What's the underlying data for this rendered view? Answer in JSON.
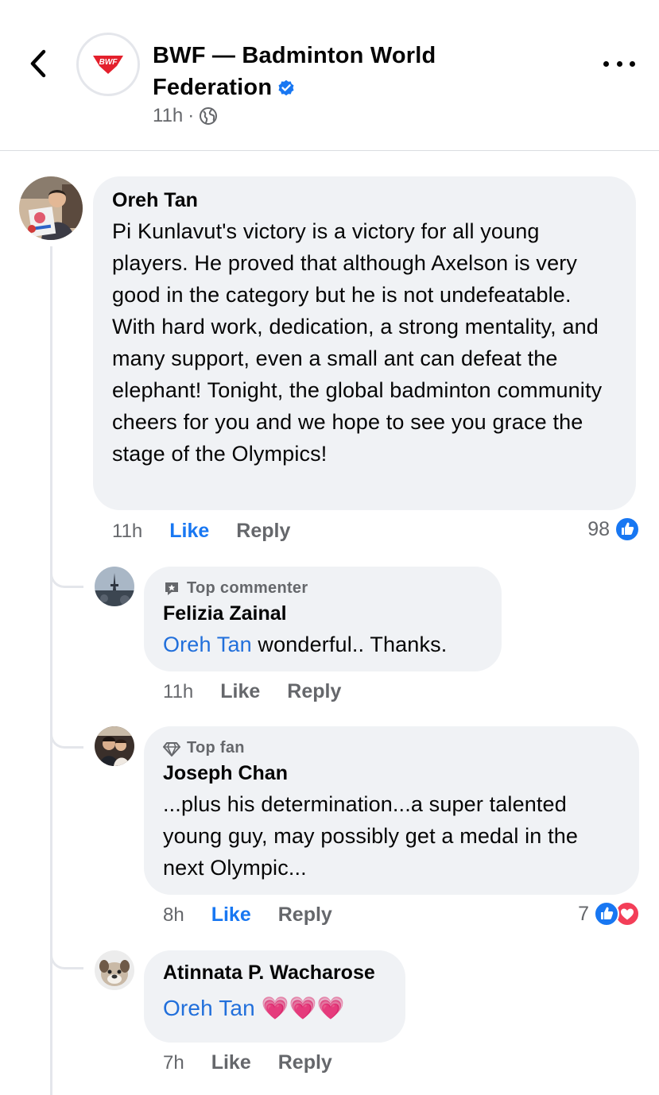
{
  "header": {
    "page_name": "BWF — Badminton World Federation",
    "time": "11h",
    "dot": "·",
    "logo_text": "BWF",
    "icons": {
      "back": "chevron-left-icon",
      "verified": "verified-badge-icon",
      "audience": "globe-icon",
      "more": "more-horizontal-icon"
    }
  },
  "colors": {
    "link": "#216fdb",
    "like_active": "#1877f2",
    "bubble": "#f0f2f5",
    "secondary_text": "#65676b",
    "logo_red": "#e4202c"
  },
  "comments": [
    {
      "author": "Oreh Tan",
      "text": "Pi Kunlavut's victory is a victory for all young players. He proved that although Axelson is very good in the category but he is not undefeatable. With hard work, dedication, a strong mentality, and many support, even a small ant can defeat the elephant! Tonight, the global badminton community cheers for you and we hope to see you grace the stage of the Olympics!",
      "time": "11h",
      "like_label": "Like",
      "reply_label": "Reply",
      "reaction_count": "98",
      "reactions": [
        "like"
      ]
    }
  ],
  "replies": [
    {
      "badge": "Top commenter",
      "author": "Felizia Zainal",
      "mention": "Oreh Tan",
      "text": " wonderful.. Thanks.",
      "time": "11h",
      "like_label": "Like",
      "reply_label": "Reply"
    },
    {
      "badge": "Top fan",
      "author": "Joseph Chan",
      "text": "...plus his determination...a super talented young guy, may possibly get a medal in the next Olympic...",
      "time": "8h",
      "like_label": "Like",
      "reply_label": "Reply",
      "reaction_count": "7",
      "reactions": [
        "like",
        "love"
      ]
    },
    {
      "author": "Atinnata P. Wacharose",
      "mention": "Oreh Tan",
      "text": " 💗💗💗",
      "time": "7h",
      "like_label": "Like",
      "reply_label": "Reply"
    }
  ]
}
